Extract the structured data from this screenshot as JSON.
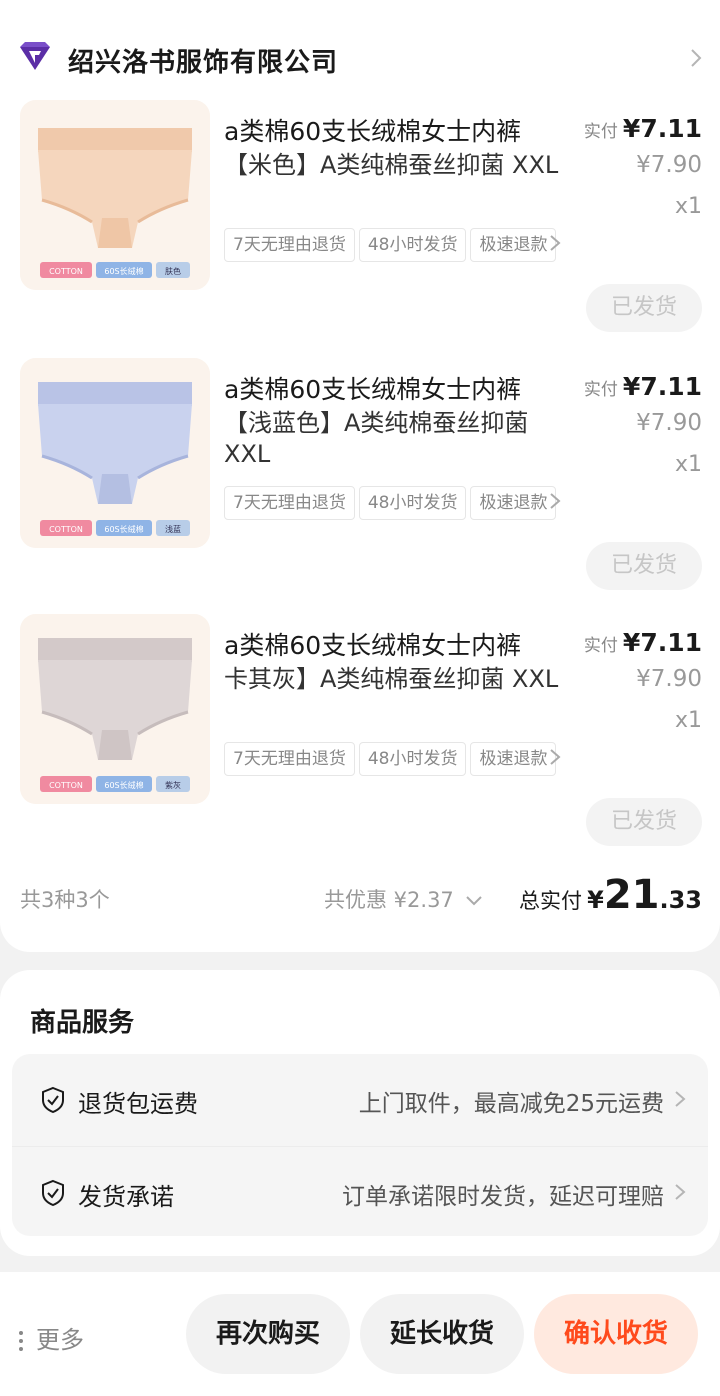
{
  "shop": {
    "name": "绍兴洛书服饰有限公司",
    "logo_icon": "diamond-shop-icon"
  },
  "items": [
    {
      "title": "a类棉60支长绒棉女士内裤",
      "spec": "【米色】A类纯棉蚕丝抑菌 XXL",
      "tags": [
        "7天无理由退货",
        "48小时发货",
        "极速退款"
      ],
      "paid_label": "实付",
      "paid_price": "¥7.11",
      "original_price": "¥7.90",
      "quantity": "x1",
      "status_button": "已发货",
      "badges": [
        "COTTON",
        "60S长绒棉",
        "肤色"
      ],
      "color": "#f5d6bd"
    },
    {
      "title": "a类棉60支长绒棉女士内裤",
      "spec": "【浅蓝色】A类纯棉蚕丝抑菌 XXL",
      "tags": [
        "7天无理由退货",
        "48小时发货",
        "极速退款"
      ],
      "paid_label": "实付",
      "paid_price": "¥7.11",
      "original_price": "¥7.90",
      "quantity": "x1",
      "status_button": "已发货",
      "badges": [
        "COTTON",
        "60S长绒棉",
        "浅蓝"
      ],
      "color": "#c9d2ee"
    },
    {
      "title": "a类棉60支长绒棉女士内裤",
      "spec": "卡其灰】A类纯棉蚕丝抑菌 XXL",
      "tags": [
        "7天无理由退货",
        "48小时发货",
        "极速退款"
      ],
      "paid_label": "实付",
      "paid_price": "¥7.11",
      "original_price": "¥7.90",
      "quantity": "x1",
      "status_button": "已发货",
      "badges": [
        "COTTON",
        "60S长绒棉",
        "紫灰"
      ],
      "color": "#ded6d6"
    }
  ],
  "summary": {
    "count": "共3种3个",
    "discount": "共优惠 ¥2.37",
    "total_label": "总实付",
    "total_currency": "¥",
    "total_int": "21",
    "total_dec": ".33"
  },
  "services": {
    "title": "商品服务",
    "rows": [
      {
        "name": "退货包运费",
        "desc": "上门取件，最高减免25元运费"
      },
      {
        "name": "发货承诺",
        "desc": "订单承诺限时发货，延迟可理赔"
      }
    ]
  },
  "bottom": {
    "more": "更多",
    "rebuy": "再次购买",
    "extend": "延长收货",
    "confirm": "确认收货"
  },
  "colors": {
    "accent": "#ff4a1c",
    "shop_logo": "#5b2ea6"
  }
}
